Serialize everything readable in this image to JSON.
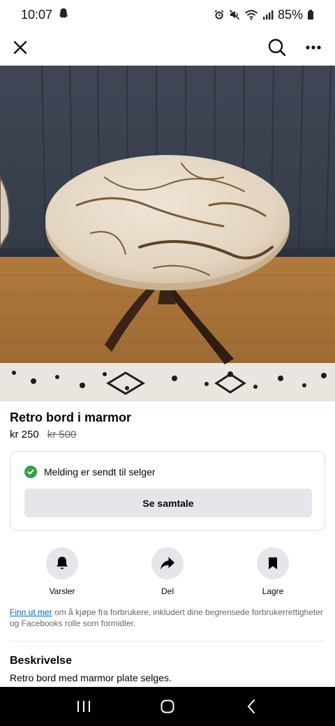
{
  "status_bar": {
    "time": "10:07",
    "battery": "85%",
    "icons": [
      "snapchat-ghost-icon",
      "alarm-icon",
      "mute-icon",
      "wifi-icon",
      "signal-icon",
      "battery-icon"
    ]
  },
  "top_bar": {
    "icons": [
      "close-icon",
      "search-icon",
      "more-icon"
    ]
  },
  "listing": {
    "title": "Retro bord i marmor",
    "price": "kr 250",
    "old_price": "kr 500"
  },
  "message": {
    "status": "Melding er sendt til selger",
    "button": "Se samtale"
  },
  "actions": [
    {
      "label": "Varsler",
      "icon": "bell-icon"
    },
    {
      "label": "Del",
      "icon": "share-icon"
    },
    {
      "label": "Lagre",
      "icon": "bookmark-icon"
    }
  ],
  "info": {
    "link": "Finn ut mer",
    "text": " om å kjøpe fra forbrukere, inkludert dine begrensede forbrukerrettigheter og Facebooks rolle som formidler."
  },
  "description": {
    "heading": "Beskrivelse",
    "text": "Retro bord med marmor plate selges."
  },
  "colors": {
    "accent_green": "#31a24c",
    "link_blue": "#0064d1",
    "button_gray": "#e4e6eb"
  }
}
